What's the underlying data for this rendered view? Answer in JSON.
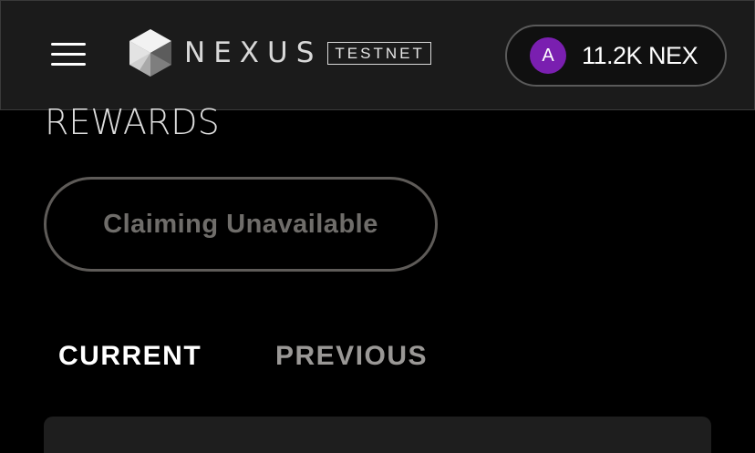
{
  "header": {
    "menu_icon": "hamburger-menu-icon",
    "logo": {
      "wordmark": "NEXUS",
      "network_badge": "TESTNET"
    },
    "wallet": {
      "avatar_initial": "A",
      "balance": "11.2K NEX",
      "avatar_color": "#7a1fb0"
    }
  },
  "rewards": {
    "title": "REWARDS",
    "claim_button_label": "Claiming Unavailable"
  },
  "tabs": [
    {
      "label": "CURRENT",
      "active": true
    },
    {
      "label": "PREVIOUS",
      "active": false
    }
  ],
  "colors": {
    "background": "#000000",
    "header_bg": "#1b1b1b",
    "disabled_text": "#6f6d6a",
    "inactive_tab": "#9a9896"
  }
}
